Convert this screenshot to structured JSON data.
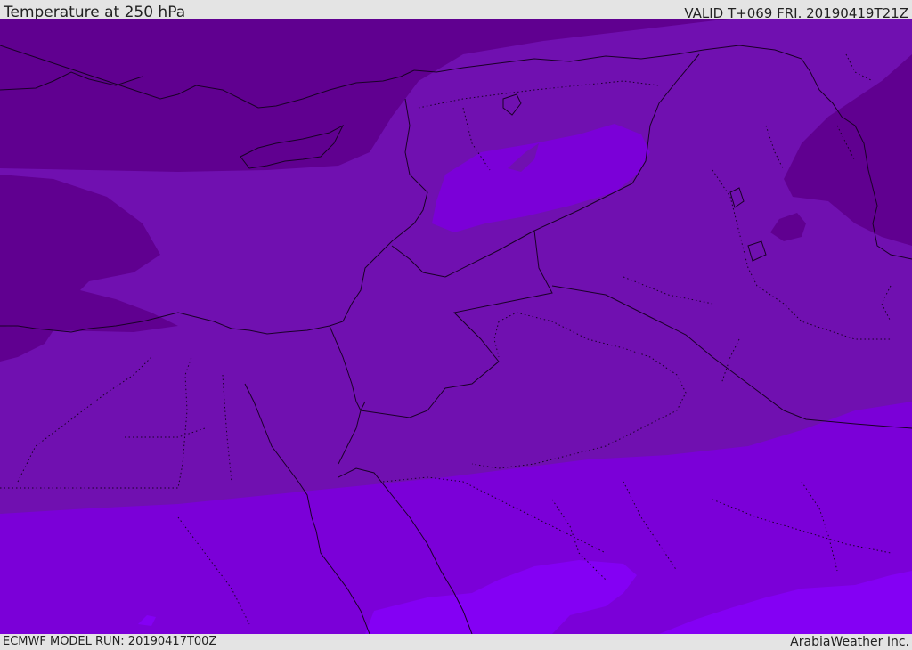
{
  "header": {
    "title": "Temperature at 250 hPa",
    "valid": "VALID T+069 FRI. 20190419T21Z"
  },
  "footer": {
    "model_run": "ECMWF MODEL RUN: 20190417T00Z",
    "credit": "ArabiaWeather Inc."
  },
  "map": {
    "field": "temperature-250hPa",
    "shading_colors": {
      "coldest": "#600090",
      "cold": "#6a0aa2",
      "mid": "#7010b0",
      "warm": "#7b00d8",
      "warmest": "#8400f4"
    },
    "border_color": "#1a0028"
  }
}
